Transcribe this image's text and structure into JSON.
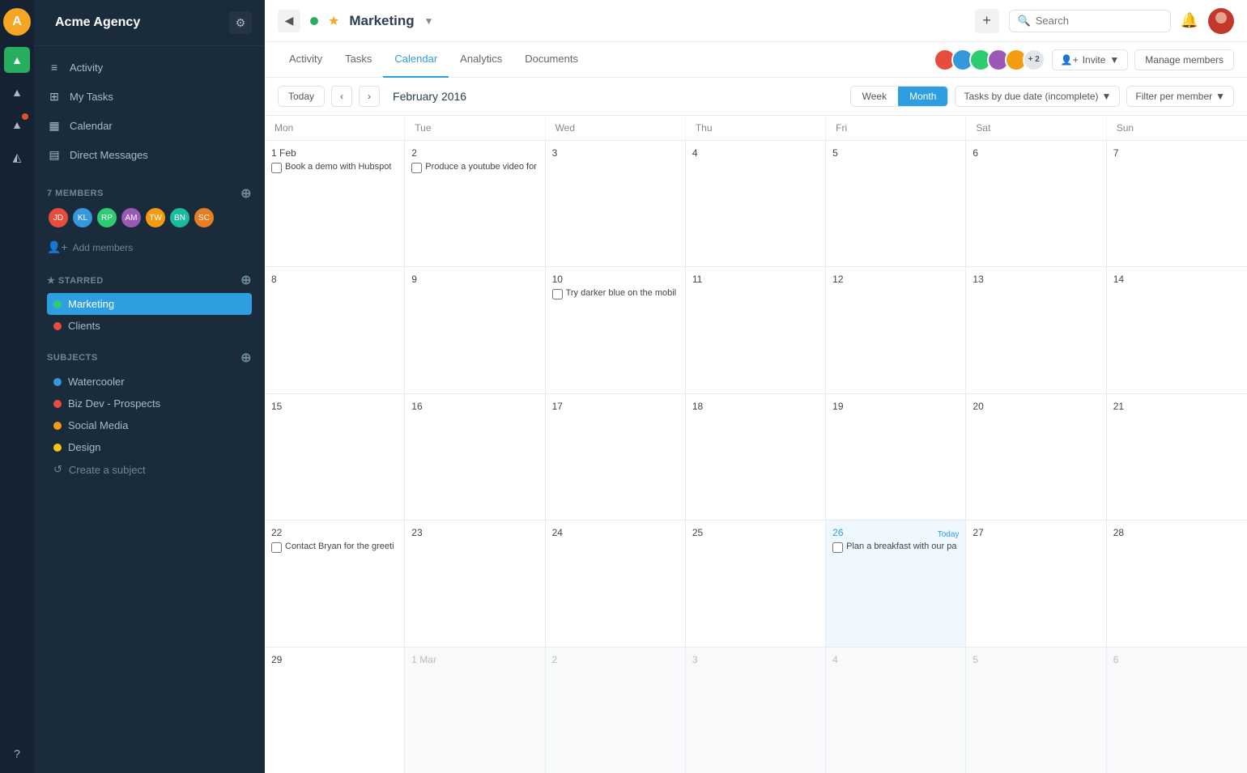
{
  "sidebar": {
    "logo_initial": "A",
    "title": "Acme Agency",
    "nav_items": [
      {
        "id": "activity",
        "label": "Activity",
        "icon": "≡"
      },
      {
        "id": "my-tasks",
        "label": "My Tasks",
        "icon": "⊞"
      },
      {
        "id": "calendar",
        "label": "Calendar",
        "icon": "▦"
      },
      {
        "id": "direct-messages",
        "label": "Direct Messages",
        "icon": "▤"
      }
    ],
    "members_section": "7 MEMBERS",
    "members": [
      {
        "id": "m1",
        "initials": "JD",
        "bg": "#e74c3c"
      },
      {
        "id": "m2",
        "initials": "KL",
        "bg": "#3498db"
      },
      {
        "id": "m3",
        "initials": "RP",
        "bg": "#2ecc71"
      },
      {
        "id": "m4",
        "initials": "AM",
        "bg": "#9b59b6"
      },
      {
        "id": "m5",
        "initials": "TW",
        "bg": "#f39c12"
      },
      {
        "id": "m6",
        "initials": "BN",
        "bg": "#1abc9c"
      },
      {
        "id": "m7",
        "initials": "SC",
        "bg": "#e67e22"
      }
    ],
    "add_members_label": "Add members",
    "starred_section": "★ STARRED",
    "starred_items": [
      {
        "id": "marketing",
        "label": "Marketing",
        "color": "#2ecc71",
        "active": true
      },
      {
        "id": "clients",
        "label": "Clients",
        "color": "#e74c3c",
        "active": false
      }
    ],
    "subjects_section": "SUBJECTS",
    "subjects": [
      {
        "id": "watercooler",
        "label": "Watercooler",
        "color": "#3498db"
      },
      {
        "id": "biz-dev",
        "label": "Biz Dev - Prospects",
        "color": "#e74c3c"
      },
      {
        "id": "social-media",
        "label": "Social Media",
        "color": "#f39c12"
      },
      {
        "id": "design",
        "label": "Design",
        "color": "#f5c518"
      }
    ],
    "create_subject_label": "Create a subject",
    "help_label": "?"
  },
  "topbar": {
    "project_name": "Marketing",
    "add_icon": "+",
    "search_placeholder": "Search",
    "member_plus_count": "+ 2"
  },
  "tabs": {
    "items": [
      {
        "id": "activity",
        "label": "Activity"
      },
      {
        "id": "tasks",
        "label": "Tasks"
      },
      {
        "id": "calendar",
        "label": "Calendar",
        "active": true
      },
      {
        "id": "analytics",
        "label": "Analytics"
      },
      {
        "id": "documents",
        "label": "Documents"
      }
    ],
    "invite_label": "Invite",
    "manage_label": "Manage members"
  },
  "calendar": {
    "today_label": "Today",
    "month_display": "February 2016",
    "view_week": "Week",
    "view_month": "Month",
    "filter_label": "Tasks by due date (incomplete)",
    "filter_member_label": "Filter per member",
    "day_headers": [
      "Mon",
      "Tue",
      "Wed",
      "Thu",
      "Fri",
      "Sat",
      "Sun"
    ],
    "weeks": [
      {
        "days": [
          {
            "num": "1 Feb",
            "other": false,
            "today": false,
            "tasks": [
              {
                "text": "Book a demo with Hubspot"
              }
            ]
          },
          {
            "num": "2",
            "other": false,
            "today": false,
            "tasks": [
              {
                "text": "Produce a youtube video for"
              }
            ]
          },
          {
            "num": "3",
            "other": false,
            "today": false,
            "tasks": []
          },
          {
            "num": "4",
            "other": false,
            "today": false,
            "tasks": []
          },
          {
            "num": "5",
            "other": false,
            "today": false,
            "tasks": []
          },
          {
            "num": "6",
            "other": false,
            "today": false,
            "tasks": []
          },
          {
            "num": "7",
            "other": false,
            "today": false,
            "tasks": []
          }
        ]
      },
      {
        "days": [
          {
            "num": "8",
            "other": false,
            "today": false,
            "tasks": []
          },
          {
            "num": "9",
            "other": false,
            "today": false,
            "tasks": []
          },
          {
            "num": "10",
            "other": false,
            "today": false,
            "tasks": [
              {
                "text": "Try darker blue on the mobil"
              }
            ]
          },
          {
            "num": "11",
            "other": false,
            "today": false,
            "tasks": []
          },
          {
            "num": "12",
            "other": false,
            "today": false,
            "tasks": []
          },
          {
            "num": "13",
            "other": false,
            "today": false,
            "tasks": []
          },
          {
            "num": "14",
            "other": false,
            "today": false,
            "tasks": []
          }
        ]
      },
      {
        "days": [
          {
            "num": "15",
            "other": false,
            "today": false,
            "tasks": []
          },
          {
            "num": "16",
            "other": false,
            "today": false,
            "tasks": []
          },
          {
            "num": "17",
            "other": false,
            "today": false,
            "tasks": []
          },
          {
            "num": "18",
            "other": false,
            "today": false,
            "tasks": []
          },
          {
            "num": "19",
            "other": false,
            "today": false,
            "tasks": []
          },
          {
            "num": "20",
            "other": false,
            "today": false,
            "tasks": []
          },
          {
            "num": "21",
            "other": false,
            "today": false,
            "tasks": []
          }
        ]
      },
      {
        "days": [
          {
            "num": "22",
            "other": false,
            "today": false,
            "tasks": [
              {
                "text": "Contact Bryan for the greeti"
              }
            ]
          },
          {
            "num": "23",
            "other": false,
            "today": false,
            "tasks": []
          },
          {
            "num": "24",
            "other": false,
            "today": false,
            "tasks": []
          },
          {
            "num": "25",
            "other": false,
            "today": false,
            "tasks": []
          },
          {
            "num": "26",
            "other": false,
            "today": true,
            "today_label": "Today",
            "tasks": [
              {
                "text": "Plan a breakfast with our pa"
              }
            ]
          },
          {
            "num": "27",
            "other": false,
            "today": false,
            "tasks": []
          },
          {
            "num": "28",
            "other": false,
            "today": false,
            "tasks": []
          }
        ]
      },
      {
        "days": [
          {
            "num": "29",
            "other": false,
            "today": false,
            "tasks": []
          },
          {
            "num": "1 Mar",
            "other": true,
            "today": false,
            "tasks": []
          },
          {
            "num": "2",
            "other": true,
            "today": false,
            "tasks": []
          },
          {
            "num": "3",
            "other": true,
            "today": false,
            "tasks": []
          },
          {
            "num": "4",
            "other": true,
            "today": false,
            "tasks": []
          },
          {
            "num": "5",
            "other": true,
            "today": false,
            "tasks": []
          },
          {
            "num": "6",
            "other": true,
            "today": false,
            "tasks": []
          }
        ]
      }
    ]
  },
  "colors": {
    "sidebar_bg": "#1a2b3c",
    "active_tab": "#2d9ee0",
    "today_highlight": "#2d9ee0"
  }
}
